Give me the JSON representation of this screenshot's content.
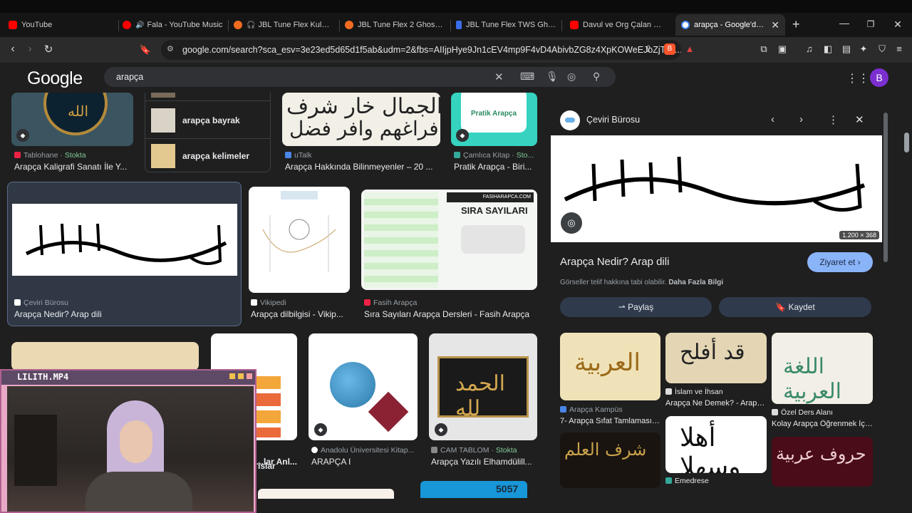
{
  "tabs": [
    {
      "label": "YouTube",
      "favcolor": "#ff0000"
    },
    {
      "label": "Fala - YouTube Music",
      "favcolor": "#ff0000"
    },
    {
      "label": "JBL Tune Flex Kulaklık",
      "favcolor": "#f26b21"
    },
    {
      "label": "JBL Tune Flex 2 Ghost Edit",
      "favcolor": "#f26b21"
    },
    {
      "label": "JBL Tune Flex TWS Ghost",
      "favcolor": "#3a6ee8"
    },
    {
      "label": "Davul ve Org Çalan Müzis",
      "favcolor": "#ff0000"
    },
    {
      "label": "arapça - Google'da A",
      "favcolor": "#ffffff"
    }
  ],
  "address": {
    "url": "google.com/search?sca_esv=3e23ed5d65d1f5ab&udm=2&fbs=AIIjpHye9Jn1cEV4mp9F4vD4AbivbZG8z4XpKOWeEJoZjTy8..."
  },
  "google": {
    "logo": "Google",
    "query": "arapça",
    "avatar_letter": "B"
  },
  "results": {
    "related": [
      {
        "label": "arapça bayrak"
      },
      {
        "label": "arapça kelimeler"
      }
    ],
    "r1": [
      {
        "source": "Tablohane",
        "stock": "Stokta",
        "title": "Arapça Kaligrafi Sanatı İle Y..."
      },
      {
        "source": "uTalk",
        "title": "Arapça Hakkında Bilinmeyenler – 20 ..."
      },
      {
        "source": "Çamlıca Kitap",
        "stock": "Sto...",
        "title": "Pratik Arapça - Biri..."
      }
    ],
    "r2": [
      {
        "source": "Çeviri Bürosu",
        "title": "Arapça Nedir? Arap dili"
      },
      {
        "source": "Vikipedi",
        "title": "Arapça dilbilgisi - Vikip..."
      },
      {
        "source": "Fasih Arapça",
        "title": "Sıra Sayıları Arapça Dersleri - Fasih Arapça"
      }
    ],
    "r3": [
      {
        "source": "",
        "title": "...lar Anl..."
      },
      {
        "source": "Anadolu Üniversitesi Kitap...",
        "title": "ARAPÇA I"
      },
      {
        "source": "CAM TABLOM",
        "stock": "Stokta",
        "title": "Arapça Yazılı Elhamdülill..."
      }
    ],
    "r3_partial_title": "islar",
    "bottom_number": "5057",
    "sira_title": "SIRA SAYILARI",
    "sira_site": "FASIHARAPCA.COM",
    "pratik_label": "Pratik Arapça"
  },
  "panel": {
    "source": "Çeviri Bürosu",
    "dimensions": "1.200 × 368",
    "title": "Arapça Nedir? Arap dili",
    "visit_label": "Ziyaret et",
    "copyright_text": "Görseller telif hakkına tabi olabilir.",
    "more_info": "Daha Fazla Bilgi",
    "share_label": "Paylaş",
    "save_label": "Kaydet",
    "related": [
      {
        "source": "Arapça Kampüs",
        "title": "7- Arapça Sıfat Tamlaması /..."
      },
      {
        "source": "İslam ve İhsan",
        "title": "Arapça Ne Demek? - Arapça..."
      },
      {
        "source": "Özel Ders Alanı",
        "title": "Kolay Arapça Öğrenmek İçin..."
      },
      {
        "source": "Emedrese",
        "title": ""
      }
    ]
  },
  "pip": {
    "title": "LILITH.MP4"
  },
  "colors": {
    "accent_blue": "#8ab4f8",
    "stock_green": "#81c995",
    "chip_bg": "#303a4d"
  }
}
